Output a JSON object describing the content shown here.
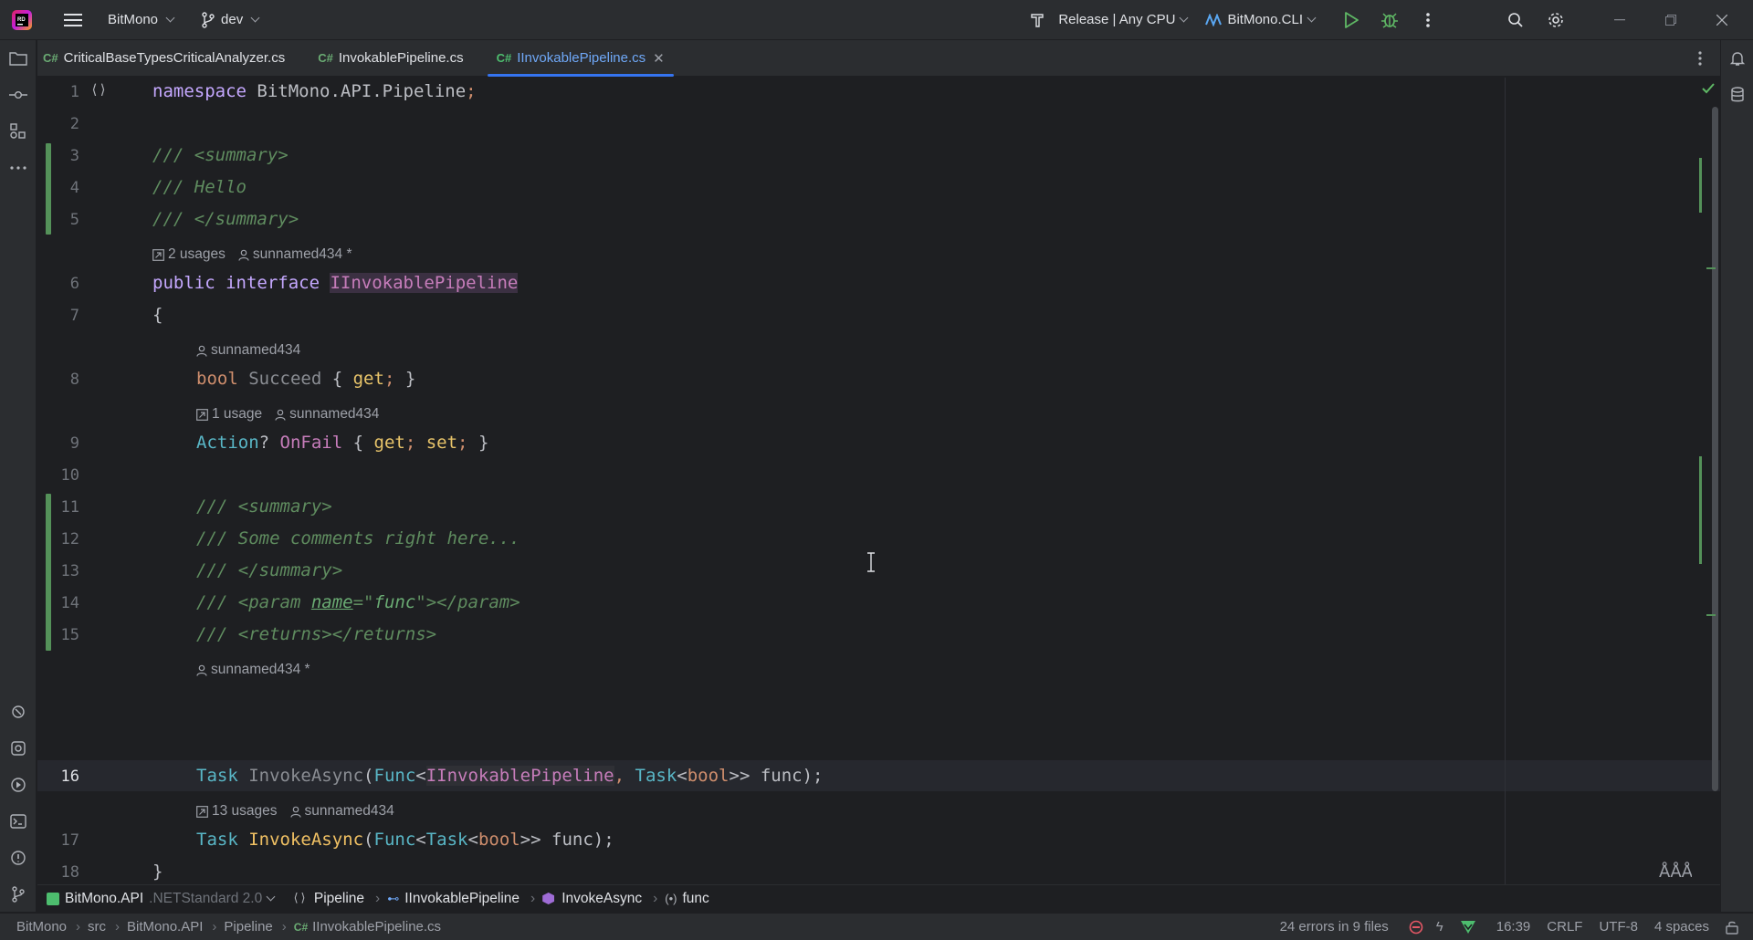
{
  "titlebar": {
    "project": "BitMono",
    "branch": "dev",
    "config": "Release | Any CPU",
    "run_config": "BitMono.CLI"
  },
  "tabs": [
    {
      "label": "CriticalBaseTypesCriticalAnalyzer.cs",
      "lang": "C#"
    },
    {
      "label": "InvokablePipeline.cs",
      "lang": "C#"
    },
    {
      "label": "IInvokablePipeline.cs",
      "lang": "C#"
    }
  ],
  "hints": {
    "usages_2": "2 usages",
    "author_star": "sunnamed434 *",
    "author": "sunnamed434",
    "usage_1": "1 usage",
    "usages_13": "13 usages"
  },
  "line_numbers": [
    "1",
    "2",
    "3",
    "4",
    "5",
    "6",
    "7",
    "8",
    "9",
    "10",
    "11",
    "12",
    "13",
    "14",
    "15",
    "16",
    "17",
    "18"
  ],
  "code": {
    "l1_kw": "namespace",
    "l1_ns": " BitMono.API.Pipeline",
    "l1_semi": ";",
    "l3": "/// <summary>",
    "l4": "/// Hello",
    "l5": "/// </summary>",
    "l6_kw": "public interface ",
    "l6_name": "IInvokablePipeline",
    "l7": "{",
    "l8_type": "bool",
    "l8_name": " Succeed",
    "l8_open": " { ",
    "l8_get": "get",
    "l8_semi": ";",
    "l8_close": " }",
    "l9_type": "Action",
    "l9_q": "? ",
    "l9_name": "OnFail",
    "l9_open": " { ",
    "l9_get": "get",
    "l9_s1": "; ",
    "l9_set": "set",
    "l9_s2": ";",
    "l9_close": " }",
    "l11": "/// <summary>",
    "l12": "/// Some comments right here...",
    "l13": "/// </summary>",
    "l14_a": "/// <param ",
    "l14_attr": "name",
    "l14_b": "=\"",
    "l14_val": "func",
    "l14_c": "\"></param>",
    "l15": "/// <returns></returns>",
    "l16_task": "Task",
    "l16_m": " InvokeAsync",
    "l16_p": "(",
    "l16_func": "Func",
    "l16_lt": "<",
    "l16_iface": "IInvokablePipeline",
    "l16_comma": ", ",
    "l16_task2": "Task",
    "l16_lt2": "<",
    "l16_bool": "bool",
    "l16_gt": ">> ",
    "l16_arg": "func",
    "l16_end": ");",
    "l17_task": "Task",
    "l17_m": " InvokeAsync",
    "l17_p": "(",
    "l17_func": "Func",
    "l17_lt": "<",
    "l17_task2": "Task",
    "l17_lt2": "<",
    "l17_bool": "bool",
    "l17_gt": ">> ",
    "l17_arg": "func",
    "l17_end": ");",
    "l18": "}"
  },
  "breadcrumb": {
    "project": "BitMono.API",
    "framework": ".NETStandard 2.0",
    "ns": "Pipeline",
    "iface": "IInvokablePipeline",
    "method": "InvokeAsync",
    "param": "func"
  },
  "statusbar": {
    "path": [
      "BitMono",
      "src",
      "BitMono.API",
      "Pipeline"
    ],
    "file": "IInvokablePipeline.cs",
    "errors": "24 errors in 9 files",
    "position": "16:39",
    "line_ending": "CRLF",
    "encoding": "UTF-8",
    "indent": "4 spaces"
  },
  "colors": {
    "accent": "#3574f0",
    "change_marker": "#549159",
    "error": "#e55765"
  }
}
